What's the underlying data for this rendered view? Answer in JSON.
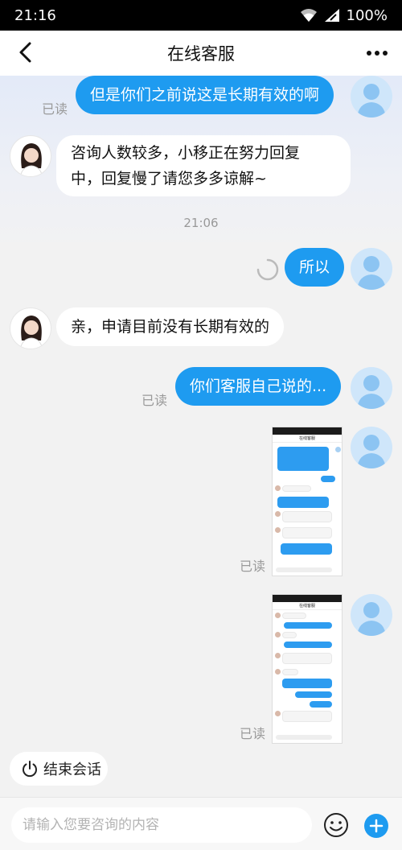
{
  "status_bar": {
    "time": "21:16",
    "battery": "100%"
  },
  "header": {
    "title": "在线客服"
  },
  "messages": [
    {
      "side": "right",
      "text": "但是你们之前说这是长期有效的啊",
      "read": "已读"
    },
    {
      "side": "left",
      "line1": "咨询人数较多，小移正在努力回复",
      "line2": "中，回复慢了请您多多谅解~"
    },
    {
      "type": "time",
      "text": "21:06"
    },
    {
      "side": "right",
      "text": "所以",
      "sending": true
    },
    {
      "side": "left",
      "text": "亲，申请目前没有长期有效的"
    },
    {
      "side": "right",
      "text": "你们客服自己说的...",
      "read": "已读"
    },
    {
      "side": "right",
      "type": "image",
      "read": "已读",
      "thumb_title": "在线客服"
    },
    {
      "side": "right",
      "type": "image",
      "read": "已读",
      "thumb_title": "在线客服"
    }
  ],
  "end_session": {
    "label": "结束会话"
  },
  "input": {
    "placeholder": "请输入您要咨询的内容"
  },
  "colors": {
    "accent": "#1e9bf0"
  }
}
